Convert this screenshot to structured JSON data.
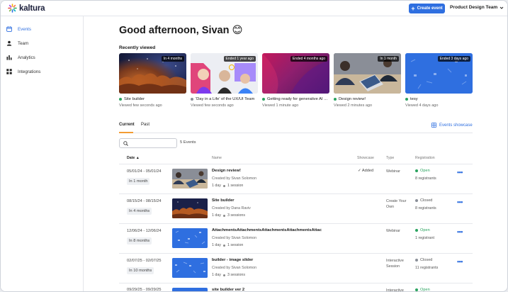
{
  "app": {
    "logo_text": "kaltura"
  },
  "topbar": {
    "create_label": "Create event",
    "team_label": "Product Design Team"
  },
  "sidebar": {
    "items": [
      {
        "label": "Events",
        "icon": "calendar-icon",
        "active": true
      },
      {
        "label": "Team",
        "icon": "person-icon",
        "active": false
      },
      {
        "label": "Analytics",
        "icon": "bar-chart-icon",
        "active": false
      },
      {
        "label": "Integrations",
        "icon": "grid-icon",
        "active": false
      }
    ]
  },
  "greeting": "Good afternoon, Sivan 😊",
  "recently_viewed": {
    "label": "Recently viewed",
    "cards": [
      {
        "badge": "In 4 months",
        "title": "Site builder",
        "sub": "Viewed few seconds ago",
        "status_color": "#2aa35f"
      },
      {
        "badge": "Ended 1 year ago",
        "title": "'Day in a Life' of the UX/UI Team",
        "sub": "Viewed few seconds ago",
        "status_color": "#8a8f98"
      },
      {
        "badge": "Ended 4 months ago",
        "title": "Getting ready for generative AI ...",
        "sub": "Viewed 1 minute ago",
        "status_color": "#2aa35f"
      },
      {
        "badge": "In 1 month",
        "title": "Design review!",
        "sub": "Viewed 2 minutes ago",
        "status_color": "#2aa35f"
      },
      {
        "badge": "Ended 3 days ago",
        "title": "tesy",
        "sub": "Viewed 4 days ago",
        "status_color": "#2aa35f"
      }
    ]
  },
  "tabs": [
    {
      "label": "Current"
    },
    {
      "label": "Past"
    }
  ],
  "showcase_link": "Events showcase",
  "events_count": "5 Events",
  "table": {
    "headers": {
      "date": "Date",
      "name": "Name",
      "showcase": "Showcase",
      "type": "Type",
      "registration": "Registration"
    },
    "rows": [
      {
        "date": "05/01/24 - 05/01/24",
        "relative": "In 1 month",
        "name": "Design review!",
        "created_by": "Created by Sivan Solomon",
        "duration": "1 day",
        "sessions": "1 session",
        "showcase": "✓ Added",
        "type": "Webinar",
        "status": "Open",
        "status_color": "#2aa35f",
        "registrants": "8 registrants",
        "thumb": "photo"
      },
      {
        "date": "08/15/24 - 08/15/24",
        "relative": "In 4 months",
        "name": "Site builder",
        "created_by": "Created by Dana Raviv",
        "duration": "1 day",
        "sessions": "3 sessions",
        "showcase": "",
        "type": "Create Your\nOwn",
        "status": "Closed",
        "status_color": "#8a8f98",
        "registrants": "8 registrants",
        "thumb": "space"
      },
      {
        "date": "12/06/24 - 12/06/24",
        "relative": "In 8 months",
        "name": "AttachmentsAttachmentsAttachmentsAttachmentsAttac",
        "created_by": "Created by Sivan Solomon",
        "duration": "1 day",
        "sessions": "1 session",
        "showcase": "",
        "type": "Webinar",
        "status": "Open",
        "status_color": "#2aa35f",
        "registrants": "1 registrant",
        "thumb": "blue"
      },
      {
        "date": "02/07/25 - 02/07/25",
        "relative": "In 10 months",
        "name": "builder - image slider",
        "created_by": "Created by Sivan Solomon",
        "duration": "1 day",
        "sessions": "3 sessions",
        "showcase": "",
        "type": "Interactive\nSession",
        "status": "Closed",
        "status_color": "#8a8f98",
        "registrants": "11 registrants",
        "thumb": "blue"
      },
      {
        "date": "09/29/25 - 09/29/25",
        "relative": "",
        "name": "site builder ver 2",
        "created_by": "",
        "duration": "",
        "sessions": "",
        "showcase": "",
        "type": "Interactive",
        "status": "Open",
        "status_color": "#2aa35f",
        "registrants": "",
        "thumb": "blue"
      }
    ]
  },
  "colors": {
    "accent": "#2f6fe0",
    "tab_underline": "#f39c34",
    "open": "#2aa35f",
    "closed": "#8a8f98"
  }
}
